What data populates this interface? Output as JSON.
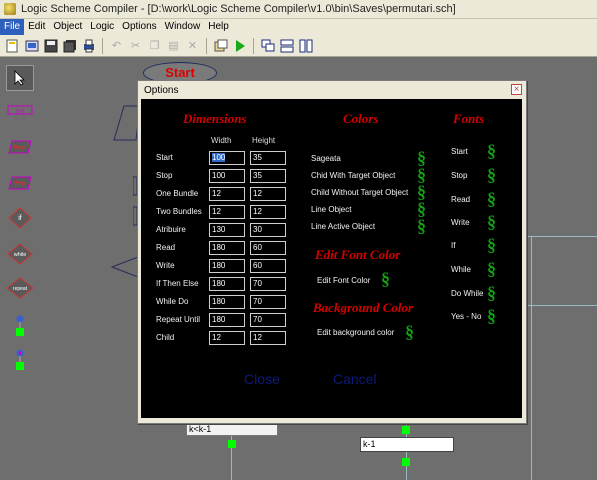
{
  "window": {
    "title": "Logic Scheme Compiler - [D:\\work\\Logic Scheme Compiler\\v1.0\\bin\\Saves\\permutari.sch]"
  },
  "menu": [
    "File",
    "Edit",
    "Object",
    "Logic",
    "Options",
    "Window",
    "Help"
  ],
  "canvas": {
    "start_label": "Start",
    "k_box1": "k<k-1",
    "k_box2": "k-1"
  },
  "left_tools": {
    "read": "Read",
    "write": "Write",
    "if": "if",
    "while": "while",
    "repeat": "repeat"
  },
  "dialog": {
    "title": "Options",
    "dimensions": {
      "heading": "Dimensions",
      "width_label": "Width",
      "height_label": "Height",
      "rows": [
        {
          "label": "Start",
          "width": "100",
          "height": "35"
        },
        {
          "label": "Stop",
          "width": "100",
          "height": "35"
        },
        {
          "label": "One Bundle",
          "width": "12",
          "height": "12"
        },
        {
          "label": "Two Bundles",
          "width": "12",
          "height": "12"
        },
        {
          "label": "Atribuire",
          "width": "130",
          "height": "30"
        },
        {
          "label": "Read",
          "width": "180",
          "height": "60"
        },
        {
          "label": "Write",
          "width": "180",
          "height": "60"
        },
        {
          "label": "If Then Else",
          "width": "180",
          "height": "70"
        },
        {
          "label": "While Do",
          "width": "180",
          "height": "70"
        },
        {
          "label": "Repeat Until",
          "width": "180",
          "height": "70"
        },
        {
          "label": "Child",
          "width": "12",
          "height": "12"
        }
      ]
    },
    "colors": {
      "heading": "Colors",
      "items": [
        "Sageata",
        "Chid With Target Object",
        "Child Without Target Object",
        "Line Object",
        "Line Active Object"
      ]
    },
    "edit_font_color": {
      "heading": "Edit Font  Color",
      "item": "Edit Font Color"
    },
    "background_color": {
      "heading": "Background Color",
      "item": "Edit background color"
    },
    "fonts": {
      "heading": "Fonts",
      "items": [
        "Start",
        "Stop",
        "Read",
        "Write",
        "If",
        "While",
        "Do While",
        "Yes - No"
      ]
    },
    "buttons": {
      "close": "Close",
      "cancel": "Cancel"
    }
  },
  "colors": {
    "heading_red": "#d40000",
    "dollar_green": "#13a013",
    "dialog_bg": "#000000"
  }
}
